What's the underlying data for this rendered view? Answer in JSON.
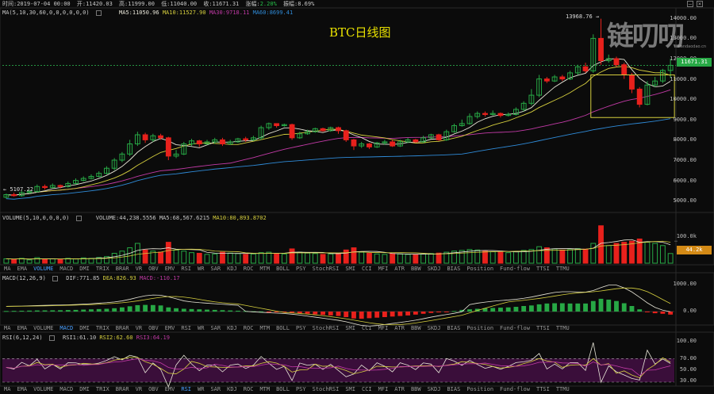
{
  "header": {
    "time": "时间:2019-07-04 00:00",
    "open": "开:11420.03",
    "high": "高:11999.00",
    "low": "低:11040.00",
    "close": "收:11671.31",
    "change_label": "涨幅:",
    "change_value": "2.20%",
    "amp": "振幅:8.69%"
  },
  "ma_legend": {
    "params": "MA(5,10,30,60,0,0,0,0,0,0)",
    "ma5": "MA5:11050.96",
    "ma10": "MA10:11527.90",
    "ma30": "MA30:9718.11",
    "ma60": "MA60:8699.41"
  },
  "title": "BTC日线图",
  "watermark": {
    "text": "链叨叨",
    "url": "liandaodao.cn"
  },
  "price_panel": {
    "y_ticks": [
      "14000.00",
      "13000.00",
      "12000.00",
      "11000.00",
      "10000.00",
      "9000.00",
      "8000.00",
      "7000.00",
      "6000.00",
      "5000.00"
    ],
    "high_label": "13968.76 →",
    "low_label": "← 5107.22",
    "last_price": "11671.31",
    "colors": {
      "up": "#27a845",
      "down": "#e8211c",
      "ma5": "#e8e6d8",
      "ma10": "#d6cf3e",
      "ma30": "#c23aa6",
      "ma60": "#2f8bd8"
    }
  },
  "volume_panel": {
    "legend_params": "VOLUME(5,10,0,0,0,0)",
    "volume": "VOLUME:44,238.5556",
    "ma5": "MA5:68,567.6215",
    "ma10": "MA10:80,893.8702",
    "y_ticks": [
      "100.0k"
    ],
    "last_tag": "44.2k"
  },
  "macd_panel": {
    "legend_params": "MACD(12,26,9)",
    "dif": "DIF:771.85",
    "dea": "DEA:826.93",
    "macd": "MACD:-110.17",
    "y_ticks": [
      "1000.00",
      "0.00"
    ]
  },
  "rsi_panel": {
    "legend_params": "RSI(6,12,24)",
    "rsi1": "RSI1:61.10",
    "rsi2": "RSI2:62.60",
    "rsi3": "RSI3:64.19",
    "y_ticks": [
      "100.00",
      "70.00",
      "50.00",
      "30.00"
    ]
  },
  "tabs": {
    "items": [
      "MA",
      "EMA",
      "VOLUME",
      "MACD",
      "DMI",
      "TRIX",
      "BRAR",
      "VR",
      "OBV",
      "EMV",
      "RSI",
      "WR",
      "SAR",
      "KDJ",
      "ROC",
      "MTM",
      "BOLL",
      "PSY",
      "StochRSI",
      "SMI",
      "CCI",
      "MFI",
      "ATR",
      "BBW",
      "SKDJ",
      "BIAS",
      "Position",
      "Fund-flow",
      "TTSI",
      "TTMU"
    ],
    "row1_active": "VOLUME",
    "row2_active": "MACD",
    "row3_active": "RSI"
  },
  "chart_data": {
    "type": "candlestick",
    "title": "BTC日线图",
    "ylim": [
      4500,
      14500
    ],
    "candles": [
      [
        5170,
        5300,
        5107,
        5350
      ],
      [
        5300,
        5250,
        5200,
        5400
      ],
      [
        5250,
        5400,
        5200,
        5500
      ],
      [
        5400,
        5450,
        5350,
        5550
      ],
      [
        5450,
        5700,
        5400,
        5800
      ],
      [
        5700,
        5650,
        5550,
        5800
      ],
      [
        5650,
        5750,
        5600,
        5850
      ],
      [
        5750,
        5700,
        5600,
        5800
      ],
      [
        5700,
        5850,
        5650,
        5950
      ],
      [
        5850,
        6000,
        5800,
        6100
      ],
      [
        6000,
        6100,
        5950,
        6200
      ],
      [
        6100,
        6200,
        6050,
        6300
      ],
      [
        6200,
        6350,
        6150,
        6450
      ],
      [
        6350,
        6600,
        6300,
        6700
      ],
      [
        6600,
        7000,
        6500,
        7100
      ],
      [
        7000,
        7300,
        6900,
        7400
      ],
      [
        7300,
        7800,
        7200,
        8000
      ],
      [
        7800,
        8250,
        7700,
        8400
      ],
      [
        8250,
        8000,
        7850,
        8350
      ],
      [
        8000,
        8200,
        7900,
        8300
      ],
      [
        8200,
        8100,
        8000,
        8300
      ],
      [
        8100,
        7200,
        7000,
        8150
      ],
      [
        7200,
        7300,
        7100,
        7500
      ],
      [
        7300,
        7800,
        7250,
        7900
      ],
      [
        7800,
        7950,
        7700,
        8050
      ],
      [
        7950,
        7800,
        7650,
        8000
      ],
      [
        7800,
        7900,
        7750,
        8000
      ],
      [
        7900,
        8000,
        7800,
        8100
      ],
      [
        8000,
        7800,
        7700,
        8100
      ],
      [
        7800,
        7900,
        7750,
        8000
      ],
      [
        7900,
        8050,
        7850,
        8100
      ],
      [
        8050,
        8000,
        7900,
        8150
      ],
      [
        8000,
        8100,
        7950,
        8200
      ],
      [
        8100,
        8600,
        8000,
        8700
      ],
      [
        8600,
        8800,
        8500,
        8850
      ],
      [
        8800,
        8700,
        8600,
        8800
      ],
      [
        8700,
        8750,
        8650,
        8800
      ],
      [
        8750,
        8100,
        8000,
        8800
      ],
      [
        8100,
        8300,
        8050,
        8400
      ],
      [
        8300,
        8400,
        8250,
        8500
      ],
      [
        8400,
        8550,
        8350,
        8600
      ],
      [
        8550,
        8450,
        8400,
        8600
      ],
      [
        8450,
        8600,
        8400,
        8650
      ],
      [
        8600,
        8450,
        8300,
        8650
      ],
      [
        8450,
        8000,
        7900,
        8500
      ],
      [
        8000,
        7700,
        7500,
        8050
      ],
      [
        7700,
        7800,
        7600,
        7900
      ],
      [
        7800,
        7650,
        7550,
        7850
      ],
      [
        7650,
        7850,
        7600,
        7900
      ],
      [
        7850,
        7900,
        7750,
        8000
      ],
      [
        7900,
        7700,
        7650,
        8000
      ],
      [
        7700,
        7900,
        7650,
        8000
      ],
      [
        7900,
        8000,
        7850,
        8100
      ],
      [
        8000,
        7900,
        7850,
        8050
      ],
      [
        7900,
        8100,
        7850,
        8200
      ],
      [
        8100,
        8250,
        8050,
        8300
      ],
      [
        8250,
        8000,
        7950,
        8300
      ],
      [
        8000,
        8400,
        7950,
        8500
      ],
      [
        8400,
        8700,
        8350,
        8800
      ],
      [
        8700,
        8800,
        8650,
        9000
      ],
      [
        8800,
        9150,
        8750,
        9300
      ],
      [
        9150,
        9300,
        9050,
        9400
      ],
      [
        9300,
        9250,
        9150,
        9400
      ],
      [
        9250,
        9300,
        9200,
        9450
      ],
      [
        9300,
        9200,
        9100,
        9350
      ],
      [
        9200,
        9250,
        9150,
        9350
      ],
      [
        9250,
        9500,
        9200,
        9600
      ],
      [
        9500,
        9800,
        9400,
        9900
      ],
      [
        9800,
        10200,
        9700,
        10500
      ],
      [
        10200,
        11000,
        10100,
        11200
      ],
      [
        11000,
        10900,
        10800,
        11100
      ],
      [
        10900,
        11100,
        10850,
        11200
      ],
      [
        11100,
        11000,
        10900,
        11200
      ],
      [
        11000,
        11300,
        10950,
        11400
      ],
      [
        11300,
        11600,
        11200,
        11700
      ],
      [
        11600,
        11400,
        11300,
        11800
      ],
      [
        11400,
        13000,
        11300,
        13200
      ],
      [
        13000,
        11900,
        11700,
        13968
      ],
      [
        11900,
        12000,
        11800,
        12200
      ],
      [
        12000,
        11700,
        11600,
        12100
      ],
      [
        11700,
        11200,
        11000,
        11800
      ],
      [
        11200,
        10500,
        10300,
        11300
      ],
      [
        10500,
        9750,
        9600,
        10600
      ],
      [
        9750,
        10700,
        9700,
        10900
      ],
      [
        10700,
        10900,
        10600,
        11100
      ],
      [
        10900,
        11420,
        10800,
        11500
      ],
      [
        11420,
        11671,
        11040,
        11999
      ]
    ],
    "volume": [
      20,
      18,
      22,
      15,
      25,
      18,
      20,
      16,
      22,
      20,
      24,
      22,
      26,
      30,
      45,
      55,
      70,
      90,
      60,
      55,
      50,
      95,
      60,
      55,
      48,
      45,
      40,
      42,
      50,
      46,
      44,
      40,
      42,
      48,
      50,
      44,
      42,
      65,
      50,
      46,
      44,
      40,
      42,
      45,
      60,
      70,
      50,
      45,
      42,
      40,
      44,
      42,
      40,
      38,
      42,
      44,
      46,
      50,
      55,
      58,
      62,
      60,
      55,
      52,
      50,
      48,
      52,
      58,
      62,
      75,
      70,
      65,
      60,
      62,
      66,
      64,
      90,
      170,
      80,
      90,
      95,
      100,
      110,
      95,
      90,
      80,
      44
    ],
    "macd_hist": [
      20,
      25,
      30,
      35,
      40,
      42,
      45,
      48,
      55,
      60,
      70,
      80,
      90,
      100,
      120,
      150,
      190,
      230,
      240,
      235,
      220,
      150,
      120,
      100,
      90,
      80,
      70,
      60,
      50,
      40,
      30,
      20,
      10,
      5,
      -5,
      -10,
      -20,
      -40,
      -60,
      -80,
      -100,
      -120,
      -140,
      -160,
      -200,
      -250,
      -260,
      -240,
      -220,
      -200,
      -180,
      -160,
      -140,
      -110,
      -80,
      -50,
      -30,
      -10,
      20,
      60,
      80,
      100,
      120,
      130,
      140,
      150,
      170,
      200,
      220,
      260,
      290,
      300,
      300,
      290,
      290,
      290,
      380,
      460,
      430,
      380,
      300,
      200,
      80,
      -20,
      -60,
      -80,
      -110
    ]
  }
}
